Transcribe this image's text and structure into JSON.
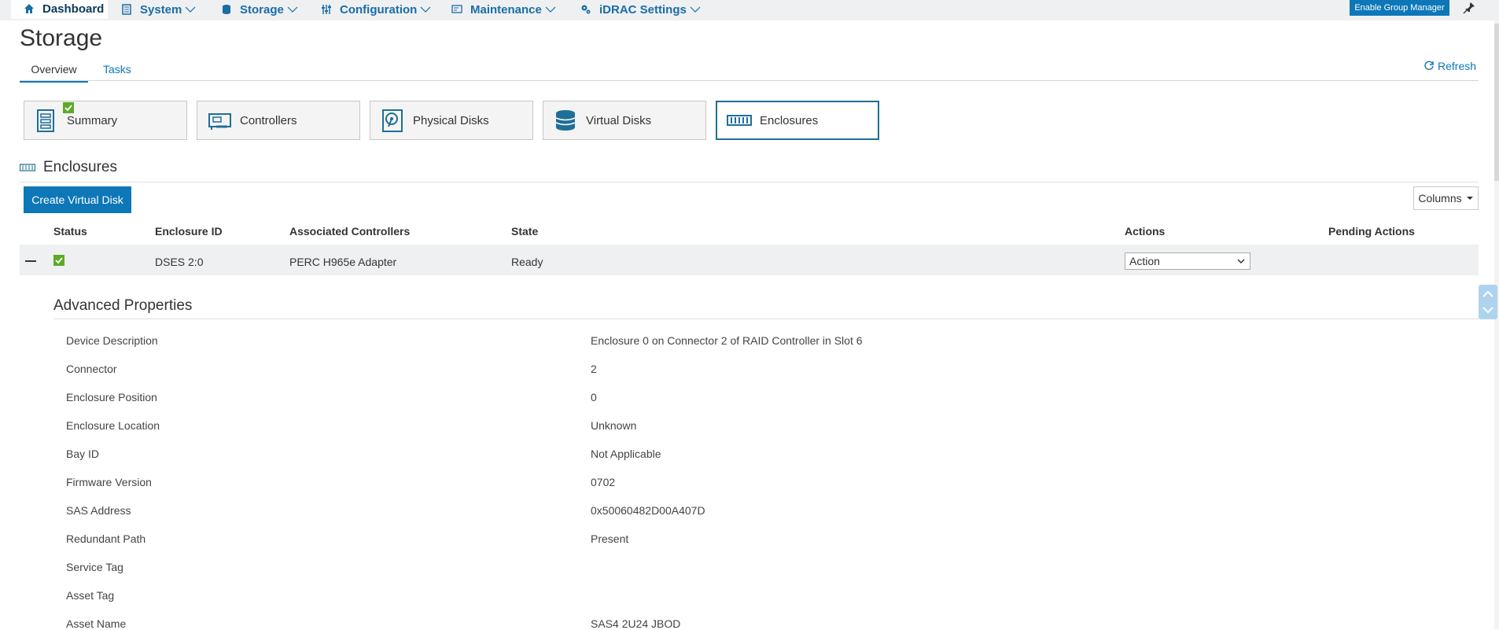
{
  "nav": {
    "items": [
      {
        "label": "Dashboard",
        "icon": "home-icon"
      },
      {
        "label": "System",
        "icon": "server-icon"
      },
      {
        "label": "Storage",
        "icon": "database-icon"
      },
      {
        "label": "Configuration",
        "icon": "sliders-icon"
      },
      {
        "label": "Maintenance",
        "icon": "monitor-icon"
      },
      {
        "label": "iDRAC Settings",
        "icon": "gears-icon"
      }
    ],
    "group_manager": "Enable Group Manager"
  },
  "page": {
    "title": "Storage",
    "tabs": [
      "Overview",
      "Tasks"
    ],
    "refresh": "Refresh"
  },
  "cards": [
    {
      "label": "Summary",
      "icon": "summary-icon"
    },
    {
      "label": "Controllers",
      "icon": "controller-icon"
    },
    {
      "label": "Physical Disks",
      "icon": "physical-disk-icon"
    },
    {
      "label": "Virtual Disks",
      "icon": "virtual-disk-icon"
    },
    {
      "label": "Enclosures",
      "icon": "enclosure-icon"
    }
  ],
  "section": {
    "title": "Enclosures",
    "create_button": "Create Virtual Disk",
    "columns_button": "Columns"
  },
  "table": {
    "headers": [
      "Status",
      "Enclosure ID",
      "Associated Controllers",
      "State",
      "Actions",
      "Pending Actions"
    ],
    "row": {
      "enclosure_id": "DSES 2:0",
      "controllers": "PERC H965e Adapter",
      "state": "Ready",
      "action": "Action"
    }
  },
  "advanced": {
    "title": "Advanced Properties",
    "properties": [
      {
        "label": "Device Description",
        "value": "Enclosure 0 on Connector 2 of RAID Controller in Slot 6"
      },
      {
        "label": "Connector",
        "value": "2"
      },
      {
        "label": "Enclosure Position",
        "value": "0"
      },
      {
        "label": "Enclosure Location",
        "value": "Unknown"
      },
      {
        "label": "Bay ID",
        "value": "Not Applicable"
      },
      {
        "label": "Firmware Version",
        "value": "0702"
      },
      {
        "label": "SAS Address",
        "value": "0x50060482D00A407D"
      },
      {
        "label": "Redundant Path",
        "value": "Present"
      },
      {
        "label": "Service Tag",
        "value": ""
      },
      {
        "label": "Asset Tag",
        "value": ""
      },
      {
        "label": "Asset Name",
        "value": "SAS4 2U24 JBOD"
      }
    ]
  },
  "colors": {
    "accent": "#0d77b8",
    "ok": "#5daa28"
  }
}
